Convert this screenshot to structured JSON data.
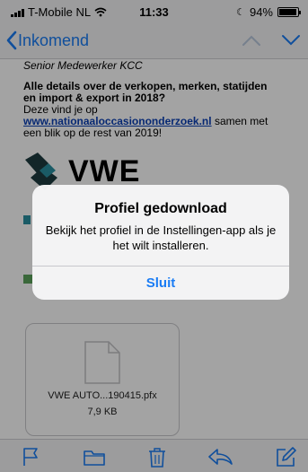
{
  "status_bar": {
    "carrier": "T-Mobile NL",
    "time": "11:33",
    "battery": "94%",
    "battery_level": 0.94
  },
  "nav": {
    "back_label": "Inkomend"
  },
  "email": {
    "sender_title": "Senior Medewerker KCC",
    "headline_line1": "Alle details over de verkopen, merken, statijden",
    "headline_line2": "en import & export in 2018?",
    "body_line1": "Deze vind je op",
    "link_text": "www.nationaaloccasiononderzoek.nl",
    "body_line2": " samen met",
    "body_line3": "een blik op de rest van 2019!",
    "logo_text": "VWE"
  },
  "attachment": {
    "file_name": "VWE AUTO...190415.pfx",
    "file_size": "7,9 KB"
  },
  "alert": {
    "title": "Profiel gedownload",
    "message": "Bekijk het profiel in de Instellingen-app als je het wilt installeren.",
    "button_label": "Sluit"
  },
  "colors": {
    "accent": "#1a7cf4",
    "link": "#0a3fb5"
  },
  "icons": {
    "toolbar": [
      "flag-icon",
      "folder-icon",
      "trash-icon",
      "reply-icon",
      "compose-icon"
    ]
  }
}
